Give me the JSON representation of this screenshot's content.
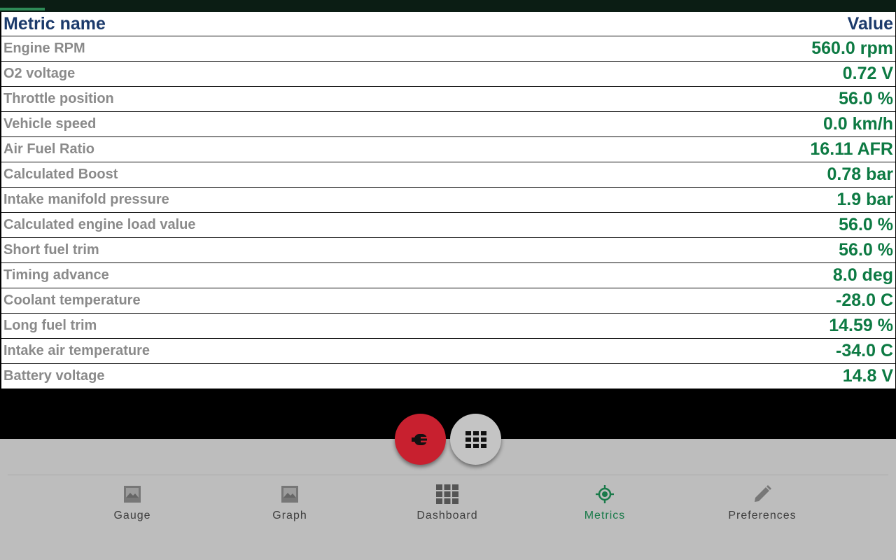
{
  "table": {
    "header": {
      "name": "Metric name",
      "value": "Value"
    },
    "rows": [
      {
        "name": "Engine RPM",
        "value": "560.0 rpm"
      },
      {
        "name": "O2 voltage",
        "value": "0.72 V"
      },
      {
        "name": "Throttle position",
        "value": "56.0 %"
      },
      {
        "name": "Vehicle speed",
        "value": "0.0 km/h"
      },
      {
        "name": "Air Fuel Ratio",
        "value": "16.11 AFR"
      },
      {
        "name": "Calculated Boost",
        "value": "0.78 bar"
      },
      {
        "name": "Intake manifold pressure",
        "value": "1.9 bar"
      },
      {
        "name": "Calculated engine load value",
        "value": "56.0 %"
      },
      {
        "name": "Short fuel trim",
        "value": "56.0 %"
      },
      {
        "name": "Timing advance",
        "value": "8.0 deg"
      },
      {
        "name": "Coolant temperature",
        "value": "-28.0 C"
      },
      {
        "name": "Long fuel trim",
        "value": "14.59 %"
      },
      {
        "name": "Intake air temperature",
        "value": "-34.0 C"
      },
      {
        "name": "Battery voltage",
        "value": "14.8 V"
      }
    ]
  },
  "fabs": {
    "connect": {
      "icon": "connector-icon",
      "color": "#c8202f"
    },
    "grid": {
      "icon": "grid-icon",
      "color": "#c4c4c4"
    }
  },
  "nav": {
    "items": [
      {
        "label": "Gauge",
        "icon": "image-icon"
      },
      {
        "label": "Graph",
        "icon": "image-icon"
      },
      {
        "label": "Dashboard",
        "icon": "grid-icon"
      },
      {
        "label": "Metrics",
        "icon": "crosshair-icon",
        "active": true
      },
      {
        "label": "Preferences",
        "icon": "pencil-icon"
      }
    ]
  },
  "colors": {
    "header_text": "#1b3a6b",
    "metric_name": "#8a8a8a",
    "metric_value": "#0d7a43",
    "active_nav": "#1a7a4a",
    "bottom_bg": "#bdbdbd"
  },
  "loading_progress": 0.05
}
